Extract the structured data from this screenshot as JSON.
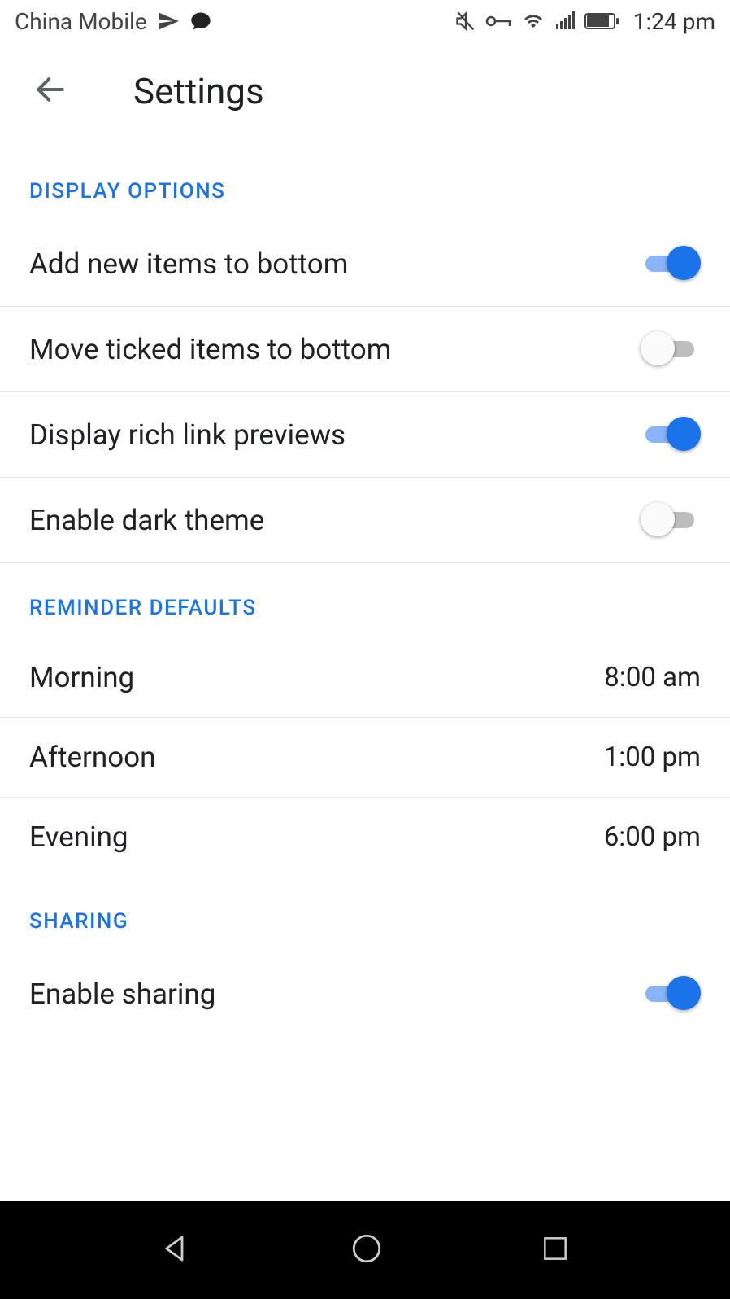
{
  "status_bar": {
    "carrier": "China Mobile",
    "time": "1:24 pm"
  },
  "app_bar": {
    "title": "Settings"
  },
  "sections": {
    "display": {
      "header": "Display options",
      "items": {
        "add_bottom": {
          "label": "Add new items to bottom",
          "on": true
        },
        "move_ticked": {
          "label": "Move ticked items to bottom",
          "on": false
        },
        "rich_links": {
          "label": "Display rich link previews",
          "on": true
        },
        "dark_theme": {
          "label": "Enable dark theme",
          "on": false
        }
      }
    },
    "reminders": {
      "header": "Reminder defaults",
      "items": {
        "morning": {
          "label": "Morning",
          "value": "8:00 am"
        },
        "afternoon": {
          "label": "Afternoon",
          "value": "1:00 pm"
        },
        "evening": {
          "label": "Evening",
          "value": "6:00 pm"
        }
      }
    },
    "sharing": {
      "header": "Sharing",
      "items": {
        "enable": {
          "label": "Enable sharing",
          "on": true
        }
      }
    }
  }
}
